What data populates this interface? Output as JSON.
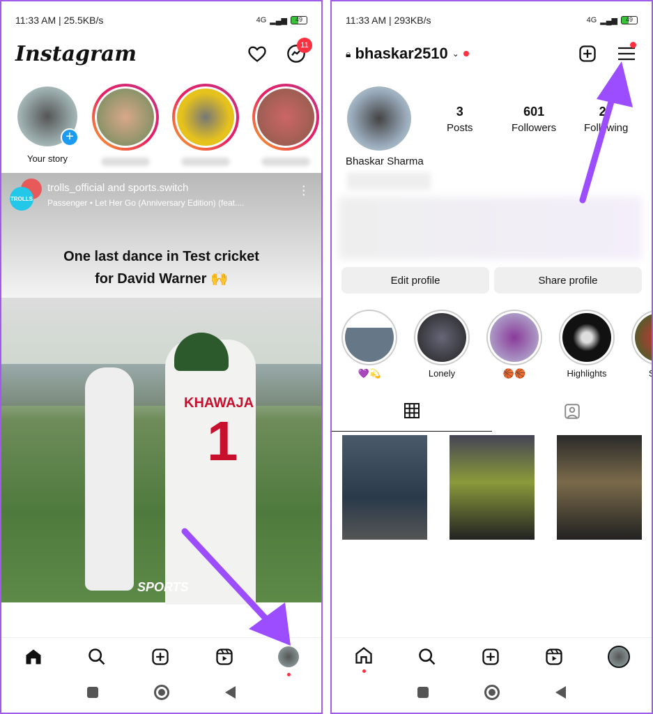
{
  "left": {
    "status": {
      "time": "11:33 AM | 25.5KB/s",
      "network": "4G",
      "battery": "49"
    },
    "logo": "Instagram",
    "messenger_badge": "11",
    "stories": [
      {
        "label": "Your story"
      },
      {
        "label": ""
      },
      {
        "label": ""
      },
      {
        "label": ""
      }
    ],
    "post": {
      "authors": "trolls_official and sports.switch",
      "audio": "Passenger • Let Her Go (Anniversary Edition) (feat....",
      "caption": "One last dance in Test cricket for David Warner 🙌",
      "jersey_name": "KHAWAJA",
      "jersey_number": "1",
      "watermark": "SPORTS"
    },
    "nav": [
      "home-icon",
      "search-icon",
      "create-icon",
      "reels-icon",
      "profile-icon"
    ]
  },
  "right": {
    "status": {
      "time": "11:33 AM | 293KB/s",
      "network": "4G",
      "battery": "49"
    },
    "username": "bhaskar2510",
    "stats": [
      {
        "value": "3",
        "label": "Posts"
      },
      {
        "value": "601",
        "label": "Followers"
      },
      {
        "value": "27",
        "label": "Following"
      }
    ],
    "display_name": "Bhaskar Sharma",
    "buttons": {
      "edit": "Edit profile",
      "share": "Share profile"
    },
    "highlights": [
      {
        "label": "💜💫"
      },
      {
        "label": "Lonely"
      },
      {
        "label": "🏀🏀"
      },
      {
        "label": "Highlights"
      },
      {
        "label": "Sill-B"
      }
    ],
    "tabs": [
      "grid-icon",
      "tagged-icon"
    ]
  },
  "colors": {
    "accent_arrow": "#9b4dff",
    "notification": "#ff3040",
    "border": "#a05ce8"
  }
}
